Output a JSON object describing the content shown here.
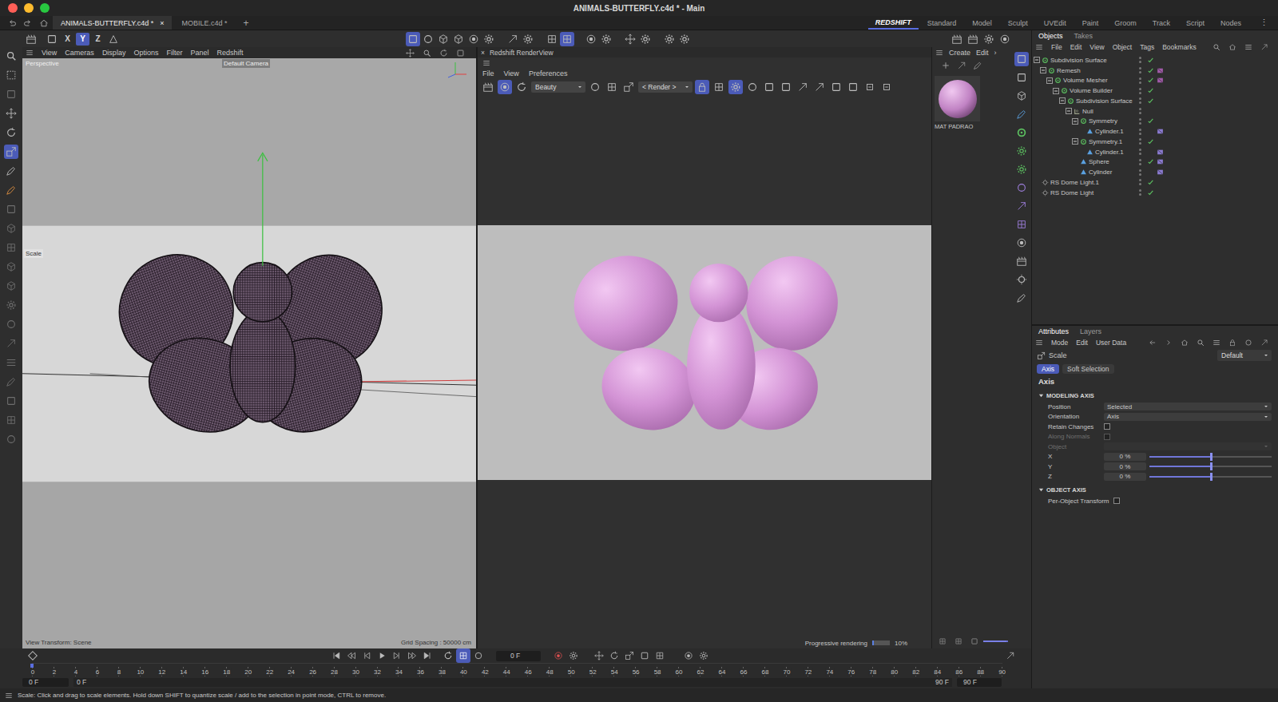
{
  "window": {
    "title": "ANIMALS-BUTTERFLY.c4d * - Main"
  },
  "doc_tabs": [
    {
      "label": "ANIMALS-BUTTERFLY.c4d *",
      "selected": true,
      "close": "×"
    },
    {
      "label": "MOBILE.c4d *",
      "selected": false
    }
  ],
  "new_tab": "+",
  "layouts": [
    {
      "label": "REDSHIFT",
      "selected": true
    },
    {
      "label": "Standard",
      "selected": false
    },
    {
      "label": "Model",
      "selected": false
    },
    {
      "label": "Sculpt",
      "selected": false
    },
    {
      "label": "UVEdit",
      "selected": false
    },
    {
      "label": "Paint",
      "selected": false
    },
    {
      "label": "Groom",
      "selected": false
    },
    {
      "label": "Track",
      "selected": false
    },
    {
      "label": "Script",
      "selected": false
    },
    {
      "label": "Nodes",
      "selected": false
    }
  ],
  "layouts_more": "⋮",
  "axis_buttons": [
    {
      "label": "X",
      "on": false
    },
    {
      "label": "Y",
      "on": true
    },
    {
      "label": "Z",
      "on": false
    }
  ],
  "toolbar_groups": [
    [
      {
        "on": true
      },
      {
        "on": false
      },
      {
        "on": false
      },
      {
        "on": false
      },
      {
        "on": false
      },
      {
        "on": false
      }
    ],
    [
      {
        "on": false
      },
      {
        "on": false
      }
    ],
    [
      {
        "on": false
      },
      {
        "on": true
      }
    ],
    [
      {
        "on": false
      },
      {
        "on": false
      }
    ],
    [
      {
        "on": false
      },
      {
        "on": false
      }
    ],
    [
      {
        "on": false
      },
      {
        "on": false
      }
    ]
  ],
  "left_tools": [
    {
      "selected": false,
      "disabled": false
    },
    {
      "selected": false,
      "disabled": false
    },
    {
      "selected": false,
      "disabled": true
    },
    {
      "selected": false,
      "disabled": false
    },
    {
      "selected": false,
      "disabled": false
    },
    {
      "selected": true,
      "disabled": false
    },
    {
      "selected": false,
      "disabled": false
    },
    {
      "selected": false,
      "disabled": false
    },
    {
      "selected": false,
      "disabled": true
    },
    {
      "selected": false,
      "disabled": true
    },
    {
      "selected": false,
      "disabled": true
    },
    {
      "selected": false,
      "disabled": true
    },
    {
      "selected": false,
      "disabled": true
    },
    {
      "selected": false,
      "disabled": true
    },
    {
      "selected": false,
      "disabled": true
    },
    {
      "selected": false,
      "disabled": true
    },
    {
      "selected": false,
      "disabled": true
    },
    {
      "selected": false,
      "disabled": true
    },
    {
      "selected": false,
      "disabled": true
    },
    {
      "selected": false,
      "disabled": true
    },
    {
      "selected": false,
      "disabled": true
    }
  ],
  "right_tools": [
    {
      "on": true
    },
    {
      "on": false
    },
    {
      "on": false
    },
    {
      "on": false
    },
    {
      "on": false
    },
    {
      "on": false
    },
    {
      "on": false
    },
    {
      "on": false
    },
    {
      "on": false
    },
    {
      "on": false
    },
    {
      "on": false
    },
    {
      "on": false
    },
    {
      "on": false
    },
    {
      "on": false
    }
  ],
  "viewport": {
    "menu": [
      "View",
      "Cameras",
      "Display",
      "Options",
      "Filter",
      "Panel",
      "Redshift"
    ],
    "camera_mode": "Perspective",
    "camera": "Default Camera",
    "tool_tag": "Scale",
    "transform": "View Transform: Scene",
    "grid": "Grid Spacing : 50000 cm"
  },
  "renderview": {
    "close": "×",
    "title": "Redshift RenderView",
    "menu": [
      "File",
      "View",
      "Preferences"
    ],
    "toolbar": [
      {
        "kind": "icon",
        "on": false
      },
      {
        "kind": "icon",
        "on": true
      },
      {
        "kind": "icon",
        "on": false
      },
      {
        "kind": "dropdown",
        "value": "Beauty"
      },
      {
        "kind": "icon",
        "on": false
      },
      {
        "kind": "icon",
        "on": false
      },
      {
        "kind": "icon",
        "on": false
      },
      {
        "kind": "dropdown",
        "value": "< Render >"
      },
      {
        "kind": "icon",
        "on": true
      },
      {
        "kind": "icon",
        "on": false
      },
      {
        "kind": "icon",
        "on": true
      },
      {
        "kind": "icon",
        "on": false
      },
      {
        "kind": "icon",
        "on": false
      },
      {
        "kind": "icon",
        "on": false
      },
      {
        "kind": "icon",
        "on": false
      },
      {
        "kind": "icon",
        "on": false
      },
      {
        "kind": "icon",
        "on": false
      },
      {
        "kind": "icon",
        "on": false
      },
      {
        "kind": "icon",
        "on": false
      },
      {
        "kind": "icon",
        "on": false
      }
    ],
    "progress": {
      "label": "Progressive rendering",
      "level": 0.1,
      "reading": "10%"
    }
  },
  "materials": {
    "menu": [
      "Create",
      "Edit"
    ],
    "more": "›",
    "items": [
      {
        "name": "MAT PADRAO"
      }
    ],
    "zoom": {
      "level": 0.95
    }
  },
  "objects": {
    "tabs": [
      {
        "label": "Objects",
        "selected": true
      },
      {
        "label": "Takes",
        "selected": false
      }
    ],
    "menu": [
      "File",
      "Edit",
      "View",
      "Object",
      "Tags",
      "Bookmarks"
    ],
    "tree": [
      {
        "name": "Subdivision Surface",
        "depth": 0,
        "kind": "generator",
        "expandable": true,
        "expanded": true,
        "enabled": true,
        "has_tag": false
      },
      {
        "name": "Remesh",
        "depth": 1,
        "kind": "generator",
        "expandable": true,
        "expanded": true,
        "enabled": true,
        "has_tag": true
      },
      {
        "name": "Volume Mesher",
        "depth": 2,
        "kind": "generator",
        "expandable": true,
        "expanded": true,
        "enabled": true,
        "has_tag": true
      },
      {
        "name": "Volume Builder",
        "depth": 3,
        "kind": "generator",
        "expandable": true,
        "expanded": true,
        "enabled": true,
        "has_tag": false
      },
      {
        "name": "Subdivision Surface",
        "depth": 4,
        "kind": "generator",
        "expandable": true,
        "expanded": true,
        "enabled": true,
        "has_tag": false
      },
      {
        "name": "Null",
        "depth": 5,
        "kind": "null",
        "expandable": true,
        "expanded": true,
        "enabled": false,
        "has_tag": false
      },
      {
        "name": "Symmetry",
        "depth": 6,
        "kind": "generator",
        "expandable": true,
        "expanded": true,
        "enabled": true,
        "has_tag": false
      },
      {
        "name": "Cylinder.1",
        "depth": 7,
        "kind": "primitive",
        "expandable": false,
        "expanded": false,
        "enabled": false,
        "has_tag": true
      },
      {
        "name": "Symmetry.1",
        "depth": 6,
        "kind": "generator",
        "expandable": true,
        "expanded": true,
        "enabled": true,
        "has_tag": false
      },
      {
        "name": "Cylinder.1",
        "depth": 7,
        "kind": "primitive",
        "expandable": false,
        "expanded": false,
        "enabled": false,
        "has_tag": true
      },
      {
        "name": "Sphere",
        "depth": 6,
        "kind": "primitive",
        "expandable": false,
        "expanded": false,
        "enabled": true,
        "has_tag": true
      },
      {
        "name": "Cylinder",
        "depth": 6,
        "kind": "primitive",
        "expandable": false,
        "expanded": false,
        "enabled": false,
        "has_tag": true
      },
      {
        "name": "RS Dome Light.1",
        "depth": 0,
        "kind": "light",
        "expandable": false,
        "expanded": false,
        "enabled": true,
        "has_tag": false
      },
      {
        "name": "RS Dome Light",
        "depth": 0,
        "kind": "light",
        "expandable": false,
        "expanded": false,
        "enabled": true,
        "has_tag": false
      }
    ]
  },
  "attributes": {
    "tabs": [
      {
        "label": "Attributes",
        "selected": true
      },
      {
        "label": "Layers",
        "selected": false
      }
    ],
    "menu": [
      "Mode",
      "Edit",
      "User Data"
    ],
    "tool": "Scale",
    "preset": "Default",
    "subtabs": [
      {
        "label": "Axis",
        "selected": true
      },
      {
        "label": "Soft Selection",
        "selected": false
      }
    ],
    "heading": "Axis",
    "sections": [
      {
        "title": "MODELING AXIS",
        "expanded": true,
        "fields": [
          {
            "kind": "dropdown",
            "label": "Position",
            "value": "Selected",
            "disabled": false
          },
          {
            "kind": "dropdown",
            "label": "Orientation",
            "value": "Axis",
            "disabled": false
          },
          {
            "kind": "checkbox",
            "label": "Retain Changes",
            "checked": false,
            "disabled": false
          },
          {
            "kind": "checkbox",
            "label": "Along Normals",
            "checked": false,
            "disabled": true
          },
          {
            "kind": "dropdown",
            "label": "Object",
            "disabled": true
          },
          {
            "kind": "slider",
            "label": "X",
            "value": "0 %",
            "level": 0.5,
            "disabled": false
          },
          {
            "kind": "slider",
            "label": "Y",
            "value": "0 %",
            "level": 0.5,
            "disabled": false
          },
          {
            "kind": "slider",
            "label": "Z",
            "value": "0 %",
            "level": 0.5,
            "disabled": false
          }
        ]
      },
      {
        "title": "OBJECT AXIS",
        "expanded": true,
        "fields": [
          {
            "kind": "checkbox",
            "label": "Per-Object Transform",
            "checked": false,
            "disabled": false
          }
        ]
      }
    ]
  },
  "timeline": {
    "frame": "0 F",
    "ticks": [
      "0",
      "2",
      "4",
      "6",
      "8",
      "10",
      "12",
      "14",
      "16",
      "18",
      "20",
      "22",
      "24",
      "26",
      "28",
      "30",
      "32",
      "34",
      "36",
      "38",
      "40",
      "42",
      "44",
      "46",
      "48",
      "50",
      "52",
      "54",
      "56",
      "58",
      "60",
      "62",
      "64",
      "66",
      "68",
      "70",
      "72",
      "74",
      "76",
      "78",
      "80",
      "82",
      "84",
      "86",
      "88",
      "90"
    ],
    "playhead": {
      "level": 0
    },
    "start": "0 F",
    "preview_start": "0 F",
    "preview_end": "90 F",
    "end": "90 F"
  },
  "status_bar": {
    "text": "Scale: Click and drag to scale elements. Hold down SHIFT to quantize scale / add to the selection in point mode, CTRL to remove."
  }
}
